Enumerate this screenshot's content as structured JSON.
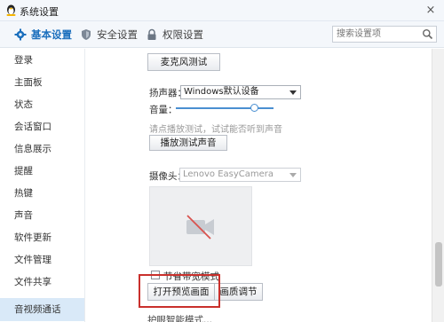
{
  "window": {
    "title": "系统设置",
    "close_glyph": "×"
  },
  "tabs": [
    {
      "label": "基本设置",
      "icon": "gear-icon",
      "active": true
    },
    {
      "label": "安全设置",
      "icon": "shield-icon",
      "active": false
    },
    {
      "label": "权限设置",
      "icon": "lock-icon",
      "active": false
    }
  ],
  "search": {
    "placeholder": "搜索设置项",
    "icon": "search-icon"
  },
  "sidebar": {
    "items": [
      {
        "label": "登录"
      },
      {
        "label": "主面板"
      },
      {
        "label": "状态"
      },
      {
        "label": "会话窗口"
      },
      {
        "label": "信息展示"
      },
      {
        "label": "提醒"
      },
      {
        "label": "热键"
      },
      {
        "label": "声音"
      },
      {
        "label": "软件更新"
      },
      {
        "label": "文件管理"
      },
      {
        "label": "文件共享"
      },
      {
        "label": "音视频通话",
        "active": true
      }
    ]
  },
  "audio": {
    "mic_test_button": "麦克风测试",
    "speaker_label": "扬声器：",
    "speaker_device": "Windows默认设备",
    "volume_label": "音量：",
    "volume_level": 0.8,
    "playback_hint": "请点播放测试，试试能否听到声音",
    "play_test_button": "播放测试声音"
  },
  "video": {
    "camera_label": "摄像头：",
    "camera_device": "Lenovo EasyCamera",
    "preview_icon": "camera-off-icon",
    "traffic_saving_label": "节省带宽模式",
    "open_preview_button": "打开预览画面",
    "quality_button": "画质调节",
    "cutoff_text": "护眼智能模式..."
  },
  "colors": {
    "accent": "#1b6fbd",
    "active_sidebar_bg": "#d9e9f8",
    "highlight_border": "#c9302c"
  }
}
